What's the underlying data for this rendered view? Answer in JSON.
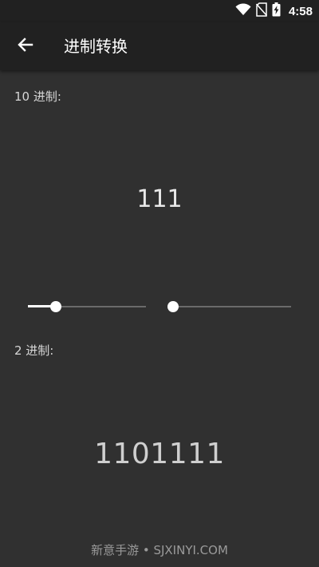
{
  "status_bar": {
    "time": "4:58",
    "icons": [
      "wifi-icon",
      "no-sim-icon",
      "battery-charging-icon"
    ]
  },
  "app_bar": {
    "title": "进制转换",
    "back_icon": "arrow-left-icon"
  },
  "decimal": {
    "label": "10 进制:",
    "value": "111"
  },
  "binary": {
    "label": "2 进制:",
    "value": "1101111"
  },
  "sliders": [
    {
      "name": "left",
      "position": 0.235
    },
    {
      "name": "right",
      "position": 0.04
    }
  ],
  "watermark": "新意手游 • SJXINYI.COM",
  "colors": {
    "background": "#303030",
    "app_bar": "#212121",
    "accent": "#ffffff"
  }
}
